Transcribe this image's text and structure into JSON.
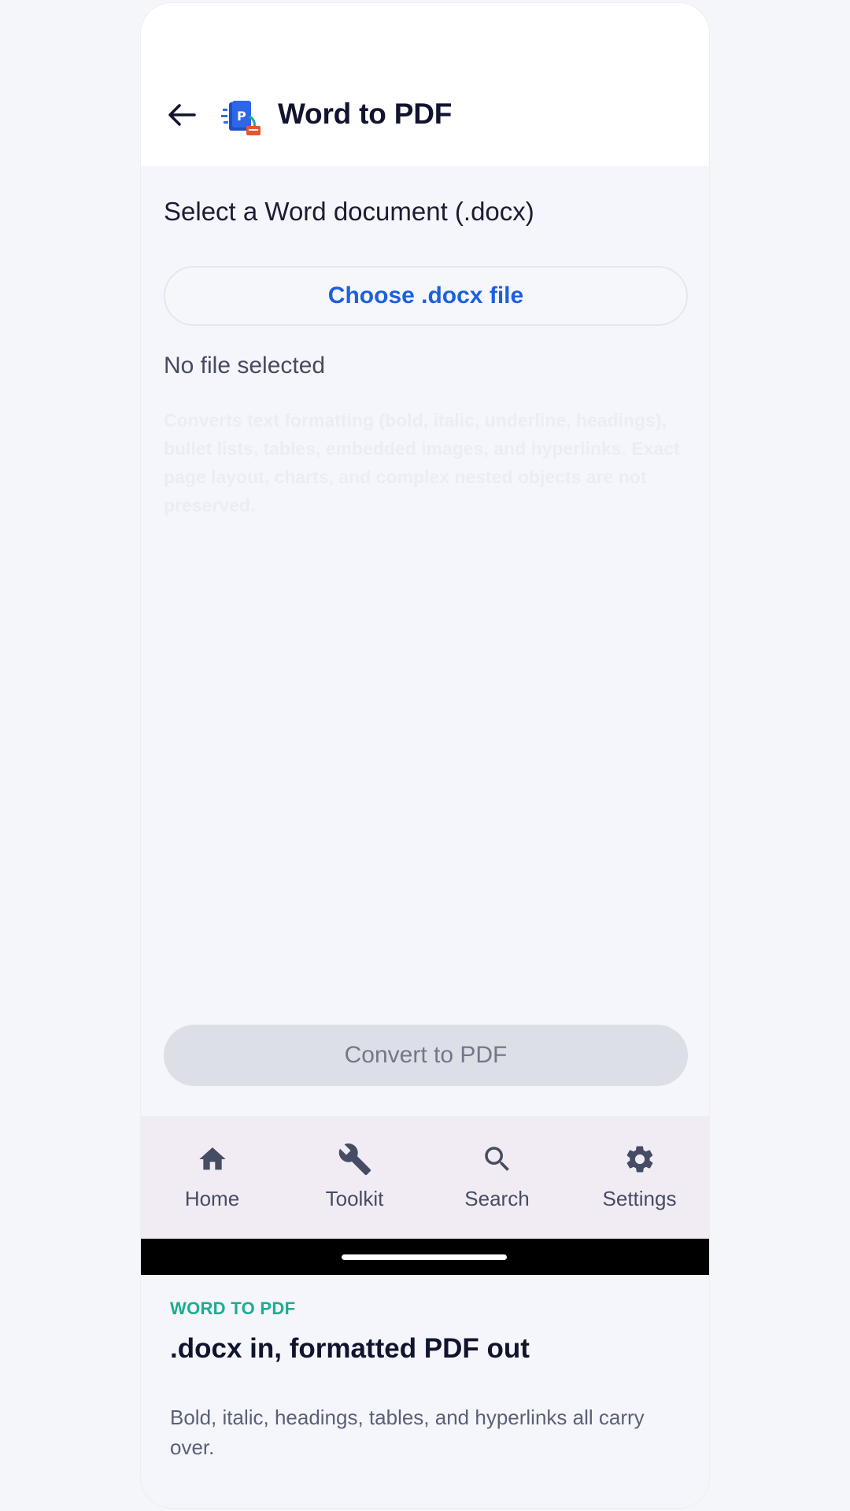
{
  "header": {
    "back_icon": "arrow-left-icon",
    "logo_icon": "word-to-pdf-app-icon",
    "title": "Word to PDF"
  },
  "main": {
    "select_label": "Select a Word document (.docx)",
    "choose_button": "Choose .docx file",
    "file_status": "No file selected",
    "hint": "Converts text formatting (bold, italic, underline, headings), bullet lists, tables, embedded images, and hyperlinks. Exact page layout, charts, and complex nested objects are not preserved.",
    "convert_button": "Convert to PDF",
    "convert_enabled": false
  },
  "nav": {
    "items": [
      {
        "label": "Home",
        "icon": "home-icon"
      },
      {
        "label": "Toolkit",
        "icon": "wrench-icon"
      },
      {
        "label": "Search",
        "icon": "search-icon"
      },
      {
        "label": "Settings",
        "icon": "gear-icon"
      }
    ]
  },
  "promo": {
    "tag": "WORD TO PDF",
    "title": ".docx in, formatted PDF out",
    "subtitle": "Bold, italic, headings, tables, and hyperlinks all carry over."
  },
  "colors": {
    "accent": "#1d5fe0",
    "promo_tag": "#1aae91",
    "nav_bg": "#f1ecf4",
    "disabled_button": "#dcdfe6"
  }
}
